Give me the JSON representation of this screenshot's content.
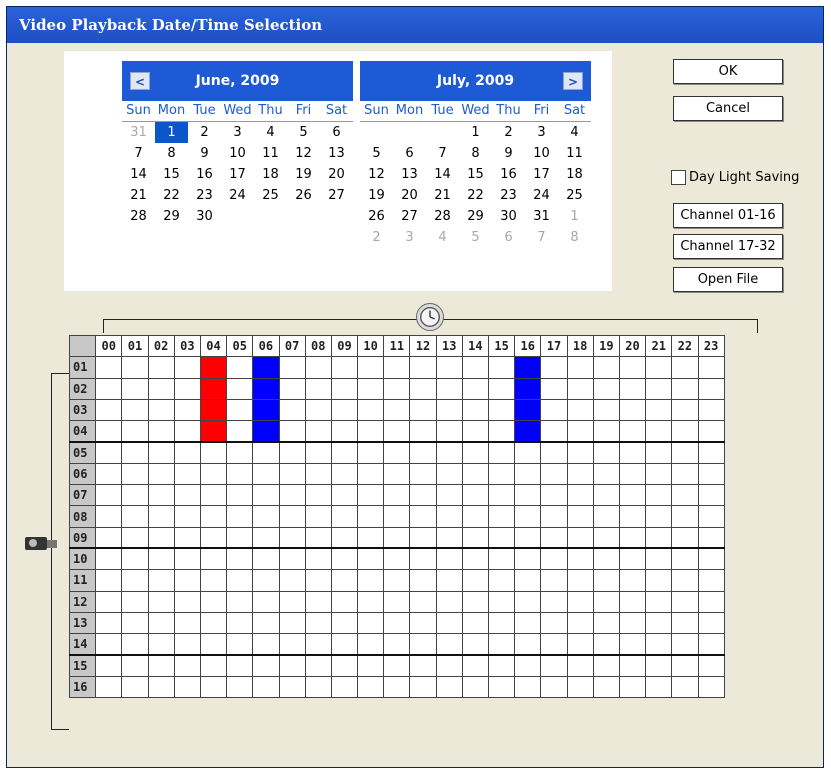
{
  "window": {
    "title": "Video Playback Date/Time Selection"
  },
  "calendars": [
    {
      "month": "June, 2009",
      "nav": "<",
      "weekdays": [
        "Sun",
        "Mon",
        "Tue",
        "Wed",
        "Thu",
        "Fri",
        "Sat"
      ],
      "days": [
        {
          "d": "31",
          "other": true
        },
        {
          "d": "1",
          "sel": true
        },
        {
          "d": "2"
        },
        {
          "d": "3"
        },
        {
          "d": "4"
        },
        {
          "d": "5"
        },
        {
          "d": "6"
        },
        {
          "d": "7"
        },
        {
          "d": "8"
        },
        {
          "d": "9"
        },
        {
          "d": "10"
        },
        {
          "d": "11"
        },
        {
          "d": "12"
        },
        {
          "d": "13"
        },
        {
          "d": "14"
        },
        {
          "d": "15"
        },
        {
          "d": "16"
        },
        {
          "d": "17"
        },
        {
          "d": "18"
        },
        {
          "d": "19"
        },
        {
          "d": "20"
        },
        {
          "d": "21"
        },
        {
          "d": "22"
        },
        {
          "d": "23"
        },
        {
          "d": "24"
        },
        {
          "d": "25"
        },
        {
          "d": "26"
        },
        {
          "d": "27"
        },
        {
          "d": "28"
        },
        {
          "d": "29"
        },
        {
          "d": "30"
        }
      ]
    },
    {
      "month": "July, 2009",
      "nav": ">",
      "weekdays": [
        "Sun",
        "Mon",
        "Tue",
        "Wed",
        "Thu",
        "Fri",
        "Sat"
      ],
      "days": [
        {
          "d": ""
        },
        {
          "d": ""
        },
        {
          "d": ""
        },
        {
          "d": "1"
        },
        {
          "d": "2"
        },
        {
          "d": "3"
        },
        {
          "d": "4"
        },
        {
          "d": "5"
        },
        {
          "d": "6"
        },
        {
          "d": "7"
        },
        {
          "d": "8"
        },
        {
          "d": "9"
        },
        {
          "d": "10"
        },
        {
          "d": "11"
        },
        {
          "d": "12"
        },
        {
          "d": "13"
        },
        {
          "d": "14"
        },
        {
          "d": "15"
        },
        {
          "d": "16"
        },
        {
          "d": "17"
        },
        {
          "d": "18"
        },
        {
          "d": "19"
        },
        {
          "d": "20"
        },
        {
          "d": "21"
        },
        {
          "d": "22"
        },
        {
          "d": "23"
        },
        {
          "d": "24"
        },
        {
          "d": "25"
        },
        {
          "d": "26"
        },
        {
          "d": "27"
        },
        {
          "d": "28"
        },
        {
          "d": "29"
        },
        {
          "d": "30"
        },
        {
          "d": "31"
        },
        {
          "d": "1",
          "other": true
        },
        {
          "d": "2",
          "other": true
        },
        {
          "d": "3",
          "other": true
        },
        {
          "d": "4",
          "other": true
        },
        {
          "d": "5",
          "other": true
        },
        {
          "d": "6",
          "other": true
        },
        {
          "d": "7",
          "other": true
        },
        {
          "d": "8",
          "other": true
        }
      ]
    }
  ],
  "buttons": {
    "ok": "OK",
    "cancel": "Cancel",
    "channel_1": "Channel 01-16",
    "channel_2": "Channel 17-32",
    "open_file": "Open File"
  },
  "daylight": {
    "label": "Day Light Saving",
    "checked": false
  },
  "grid": {
    "hours": [
      "00",
      "01",
      "02",
      "03",
      "04",
      "05",
      "06",
      "07",
      "08",
      "09",
      "10",
      "11",
      "12",
      "13",
      "14",
      "15",
      "16",
      "17",
      "18",
      "19",
      "20",
      "21",
      "22",
      "23"
    ],
    "channels": [
      "01",
      "02",
      "03",
      "04",
      "05",
      "06",
      "07",
      "08",
      "09",
      "10",
      "11",
      "12",
      "13",
      "14",
      "15",
      "16"
    ],
    "recordings": [
      {
        "hour": "04",
        "channels": [
          "01",
          "02",
          "03",
          "04"
        ],
        "color": "#ff0000"
      },
      {
        "hour": "06",
        "channels": [
          "01",
          "02",
          "03",
          "04"
        ],
        "color": "#0000ff"
      },
      {
        "hour": "16",
        "channels": [
          "01",
          "02",
          "03",
          "04"
        ],
        "color": "#0000ff"
      }
    ]
  }
}
